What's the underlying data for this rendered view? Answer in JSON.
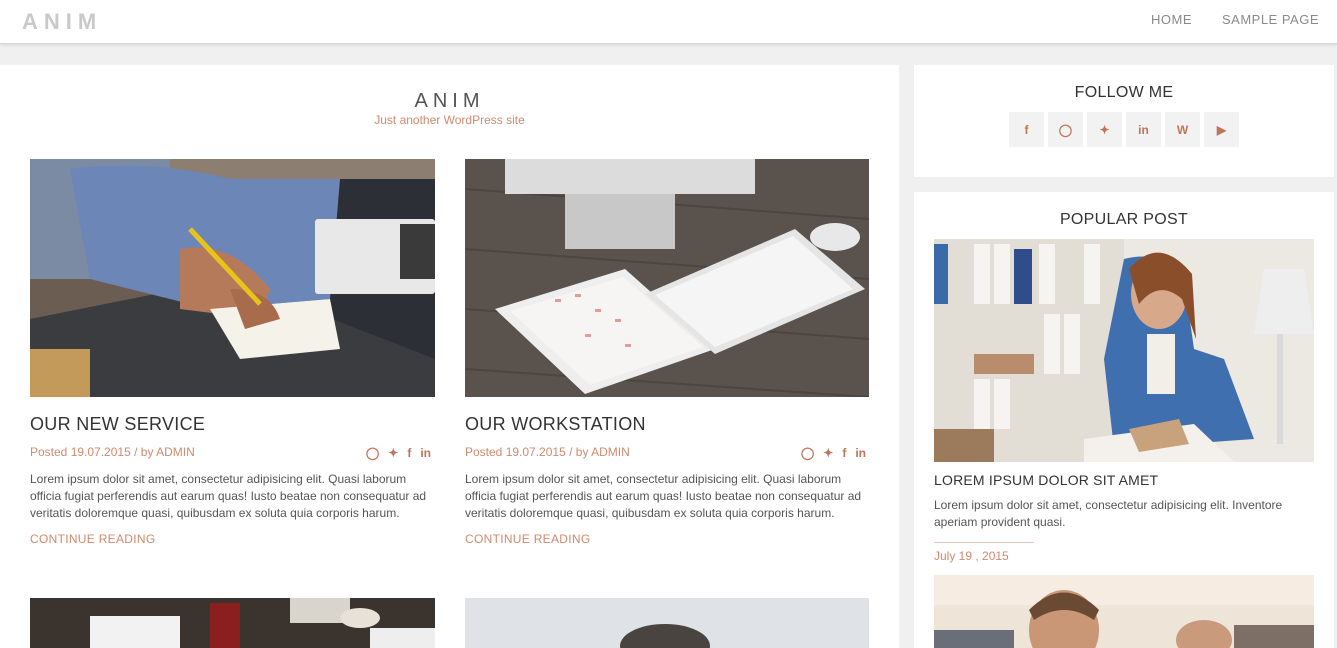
{
  "header": {
    "logo": "ANIM",
    "nav": [
      "HOME",
      "SAMPLE PAGE"
    ]
  },
  "site": {
    "title": "ANIM",
    "tagline": "Just another WordPress site"
  },
  "posts": [
    {
      "title": "OUR NEW SERVICE",
      "posted_label": "Posted 19.07.2015",
      "by_label": " / by ",
      "author": "ADMIN",
      "excerpt": "Lorem ipsum dolor sit amet, consectetur adipisicing elit. Quasi laborum officia fugiat perferendis aut earum quas! Iusto beatae non consequatur ad veritatis doloremque quasi, quibusdam ex soluta quia corporis harum.",
      "read_more": "CONTINUE READING",
      "share_icons": [
        "github-icon",
        "twitter-icon",
        "facebook-icon",
        "linkedin-icon"
      ]
    },
    {
      "title": "OUR WORKSTATION",
      "posted_label": "Posted 19.07.2015",
      "by_label": " / by ",
      "author": "ADMIN",
      "excerpt": "Lorem ipsum dolor sit amet, consectetur adipisicing elit. Quasi laborum officia fugiat perferendis aut earum quas! Iusto beatae non consequatur ad veritatis doloremque quasi, quibusdam ex soluta quia corporis harum.",
      "read_more": "CONTINUE READING",
      "share_icons": [
        "github-icon",
        "twitter-icon",
        "facebook-icon",
        "linkedin-icon"
      ]
    }
  ],
  "share_glyphs": {
    "github": "◯",
    "twitter": "🐦",
    "facebook": "f",
    "linkedin": "in"
  },
  "sidebar": {
    "follow_title": "FOLLOW ME",
    "social": [
      {
        "icon": "facebook-icon",
        "glyph": "f"
      },
      {
        "icon": "github-icon",
        "glyph": "◯"
      },
      {
        "icon": "twitter-icon",
        "glyph": "t"
      },
      {
        "icon": "linkedin-icon",
        "glyph": "in"
      },
      {
        "icon": "wordpress-icon",
        "glyph": "W"
      },
      {
        "icon": "youtube-icon",
        "glyph": "▶"
      }
    ],
    "popular_title": "POPULAR POST",
    "popular": {
      "title": "LOREM IPSUM DOLOR SIT AMET",
      "text": "Lorem ipsum dolor sit amet, consectetur adipisicing elit. Inventore aperiam provident quasi.",
      "date": "July 19 , 2015"
    }
  },
  "colors": {
    "accent": "#d08a6e",
    "heading": "#333333",
    "background": "#f0f0f0"
  }
}
